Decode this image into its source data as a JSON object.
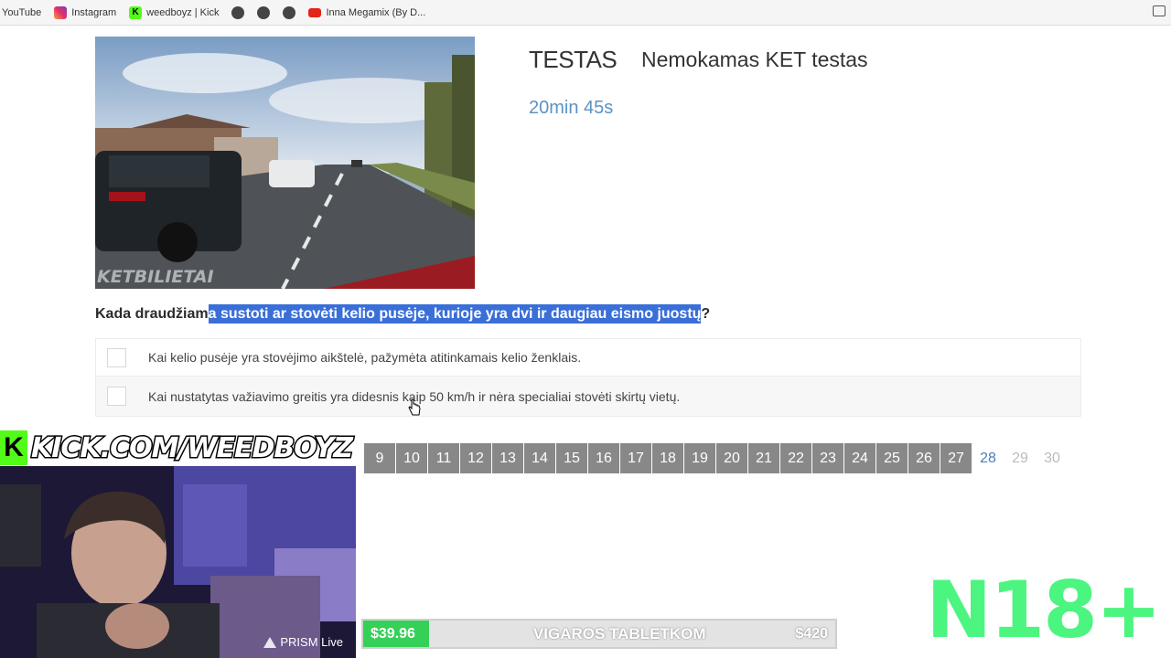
{
  "bookmarks": [
    {
      "label": "YouTube",
      "icon": "none"
    },
    {
      "label": "Instagram",
      "icon": "instagram-icon"
    },
    {
      "label": "weedboyz | Kick",
      "icon": "kick-icon"
    },
    {
      "label": "",
      "icon": "globe-icon"
    },
    {
      "label": "",
      "icon": "globe-icon"
    },
    {
      "label": "",
      "icon": "globe-icon"
    },
    {
      "label": "Inna Megamix (By D...",
      "icon": "youtube-icon"
    }
  ],
  "test": {
    "title": "TESTAS",
    "subtitle": "Nemokamas KET testas",
    "timer": "20min 45s",
    "video_watermark": "KETBILIETAI"
  },
  "question": {
    "before_highlight": "Kada draudžiam",
    "highlighted": "a sustoti ar stovėti kelio pusėje, kurioje yra dvi ir daugiau eismo juostų",
    "after_highlight": "?"
  },
  "answers": [
    {
      "text": "Kai kelio pusėje yra stovėjimo aikštelė, pažymėta atitinkamais kelio ženklais.",
      "checked": false
    },
    {
      "text": "Kai nustatytas važiavimo greitis yra didesnis kaip 50 km/h ir nėra specialiai stovėti skirtų vietų.",
      "checked": false
    }
  ],
  "pagination": {
    "pages": [
      "9",
      "10",
      "11",
      "12",
      "13",
      "14",
      "15",
      "16",
      "17",
      "18",
      "19",
      "20",
      "21",
      "22",
      "23",
      "24",
      "25",
      "26",
      "27",
      "28",
      "29",
      "30"
    ],
    "current": "28"
  },
  "overlay": {
    "kick_logo": "K",
    "kick_url": "KICK.COM/WEEDBOYZ",
    "prism_label": "PRISM Live",
    "goal": {
      "current": "$39.96",
      "title": "VIGAROS TABLETKOM",
      "target": "$420",
      "progress_fraction": 0.095,
      "fill_color": "#34d058"
    },
    "age_badge": "N18+",
    "age_badge_color": "#4cf580"
  },
  "colors": {
    "highlight": "#3a6fd8",
    "timer": "#5b93c2",
    "page_inactive": "#888888",
    "page_current": "#4a7fb5",
    "kick_green": "#53fc18"
  }
}
